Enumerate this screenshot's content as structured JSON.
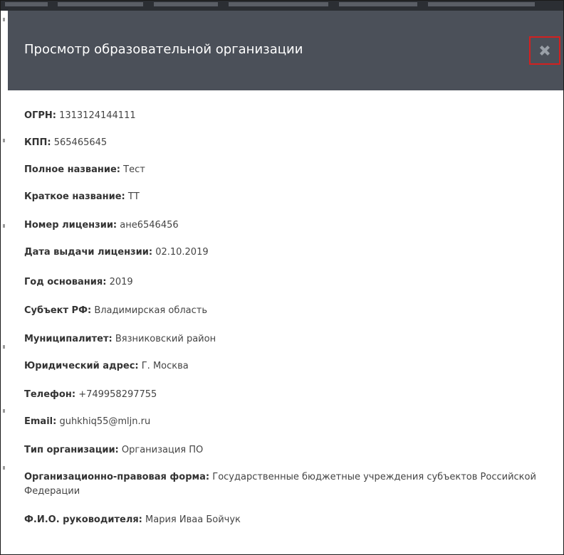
{
  "modal": {
    "title": "Просмотр образовательной организации",
    "close_icon": "close-icon"
  },
  "fields": [
    {
      "label": "ОГРН:",
      "value": "1313124144111"
    },
    {
      "label": "КПП:",
      "value": "565465645"
    },
    {
      "label": "Полное название:",
      "value": "Тест"
    },
    {
      "label": "Краткое название:",
      "value": "ТТ"
    },
    {
      "label": "Номер лицензии:",
      "value": "ане6546456"
    },
    {
      "label": "Дата выдачи лицензии:",
      "value": "02.10.2019"
    },
    {
      "label": "Год основания:",
      "value": "2019"
    },
    {
      "label": "Субъект РФ:",
      "value": "Владимирская область"
    },
    {
      "label": "Муниципалитет:",
      "value": "Вязниковский район"
    },
    {
      "label": "Юридический адрес:",
      "value": "Г. Москва"
    },
    {
      "label": "Телефон:",
      "value": "+749958297755"
    },
    {
      "label": "Email:",
      "value": "guhkhiq55@mljn.ru"
    },
    {
      "label": "Тип организации:",
      "value": "Организация ПО"
    },
    {
      "label": "Организационно-правовая форма:",
      "value": "Государственные бюджетные учреждения субъектов Российской Федерации"
    },
    {
      "label": "Ф.И.О. руководителя:",
      "value": "Мария Иваа Бойчук"
    }
  ],
  "colors": {
    "header_bg": "#4b5059",
    "close_highlight": "#d32020",
    "text": "#333333"
  }
}
